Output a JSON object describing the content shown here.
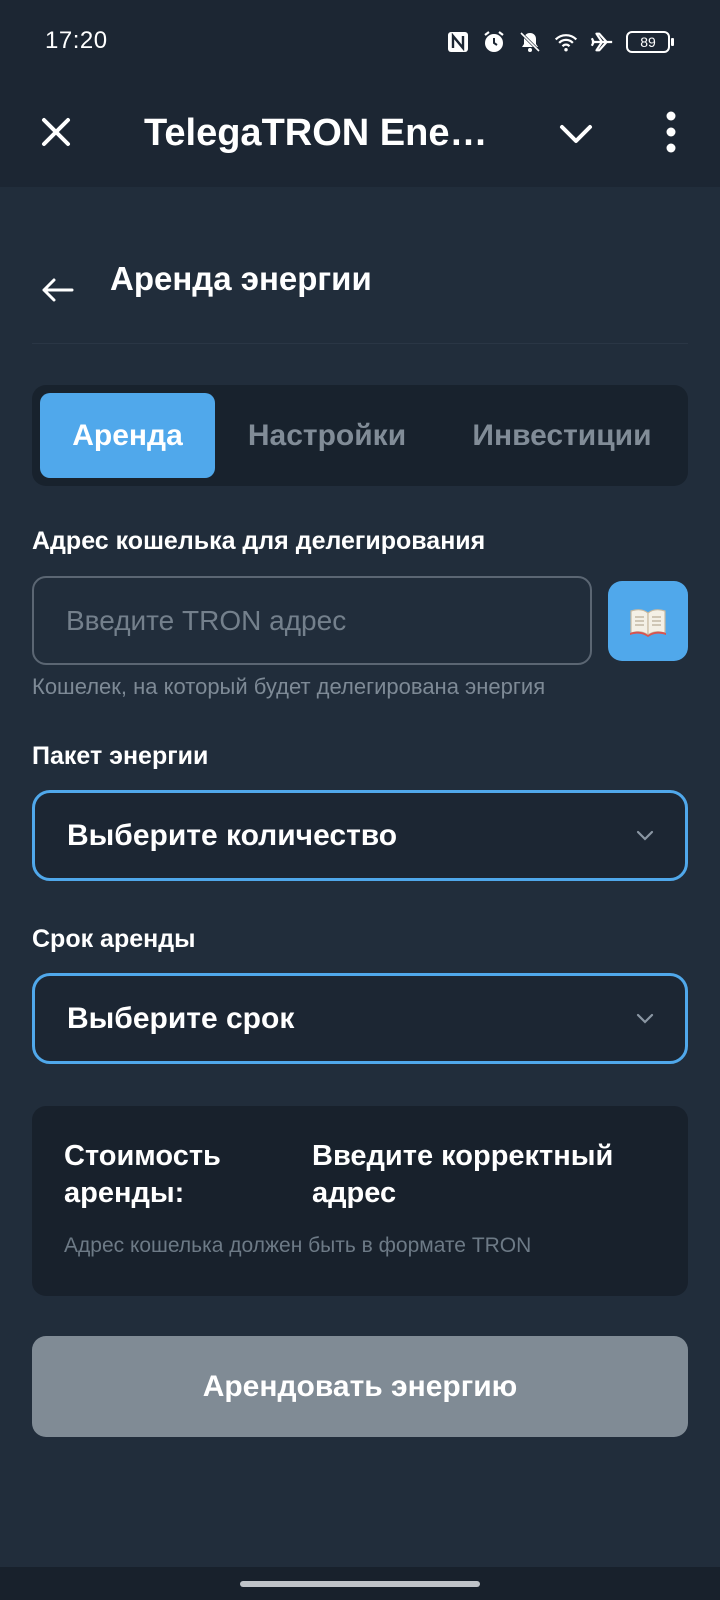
{
  "status_bar": {
    "time": "17:20",
    "icons": [
      "nfc-icon",
      "alarm-icon",
      "bell-off-icon",
      "wifi-icon",
      "airplane-icon"
    ],
    "battery": "89"
  },
  "app_bar": {
    "title": "TelegaTRON Ener..."
  },
  "page": {
    "title": "Аренда энергии"
  },
  "tabs": [
    {
      "label": "Аренда",
      "active": true
    },
    {
      "label": "Настройки",
      "active": false
    },
    {
      "label": "Инвестиции",
      "active": false
    }
  ],
  "address": {
    "label": "Адрес кошелька для делегирования",
    "placeholder": "Введите TRON адрес",
    "value": "",
    "hint": "Кошелек, на который будет делегирована энергия",
    "address_book_icon": "book-icon"
  },
  "package": {
    "label": "Пакет энергии",
    "selected": "Выберите количество"
  },
  "term": {
    "label": "Срок аренды",
    "selected": "Выберите срок"
  },
  "cost": {
    "label": "Стоимость аренды:",
    "value": "Введите корректный адрес",
    "note": "Адрес кошелька должен быть в формате TRON"
  },
  "submit": {
    "label": "Арендовать энергию"
  },
  "colors": {
    "background": "#212d3b",
    "bar": "#1c2633",
    "accent": "#50a8eb",
    "disabled_button": "#808b95"
  }
}
